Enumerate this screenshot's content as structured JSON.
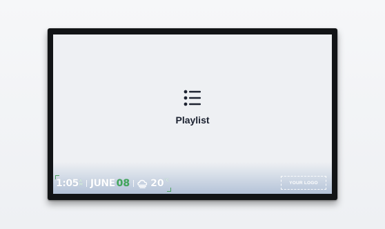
{
  "playlist": {
    "icon": "list-icon",
    "title": "Playlist"
  },
  "ticker": {
    "time": "1:05",
    "am": "A",
    "pm": "M",
    "month": "JUNE",
    "day": "08",
    "weather_icon": "cloud-icon",
    "temperature": "20",
    "temperature_unit": "°C",
    "logo_text": "YOUR LOGO"
  },
  "colors": {
    "accent_green": "#41a65a",
    "bezel": "#121416",
    "screen": "#eef0f3"
  }
}
